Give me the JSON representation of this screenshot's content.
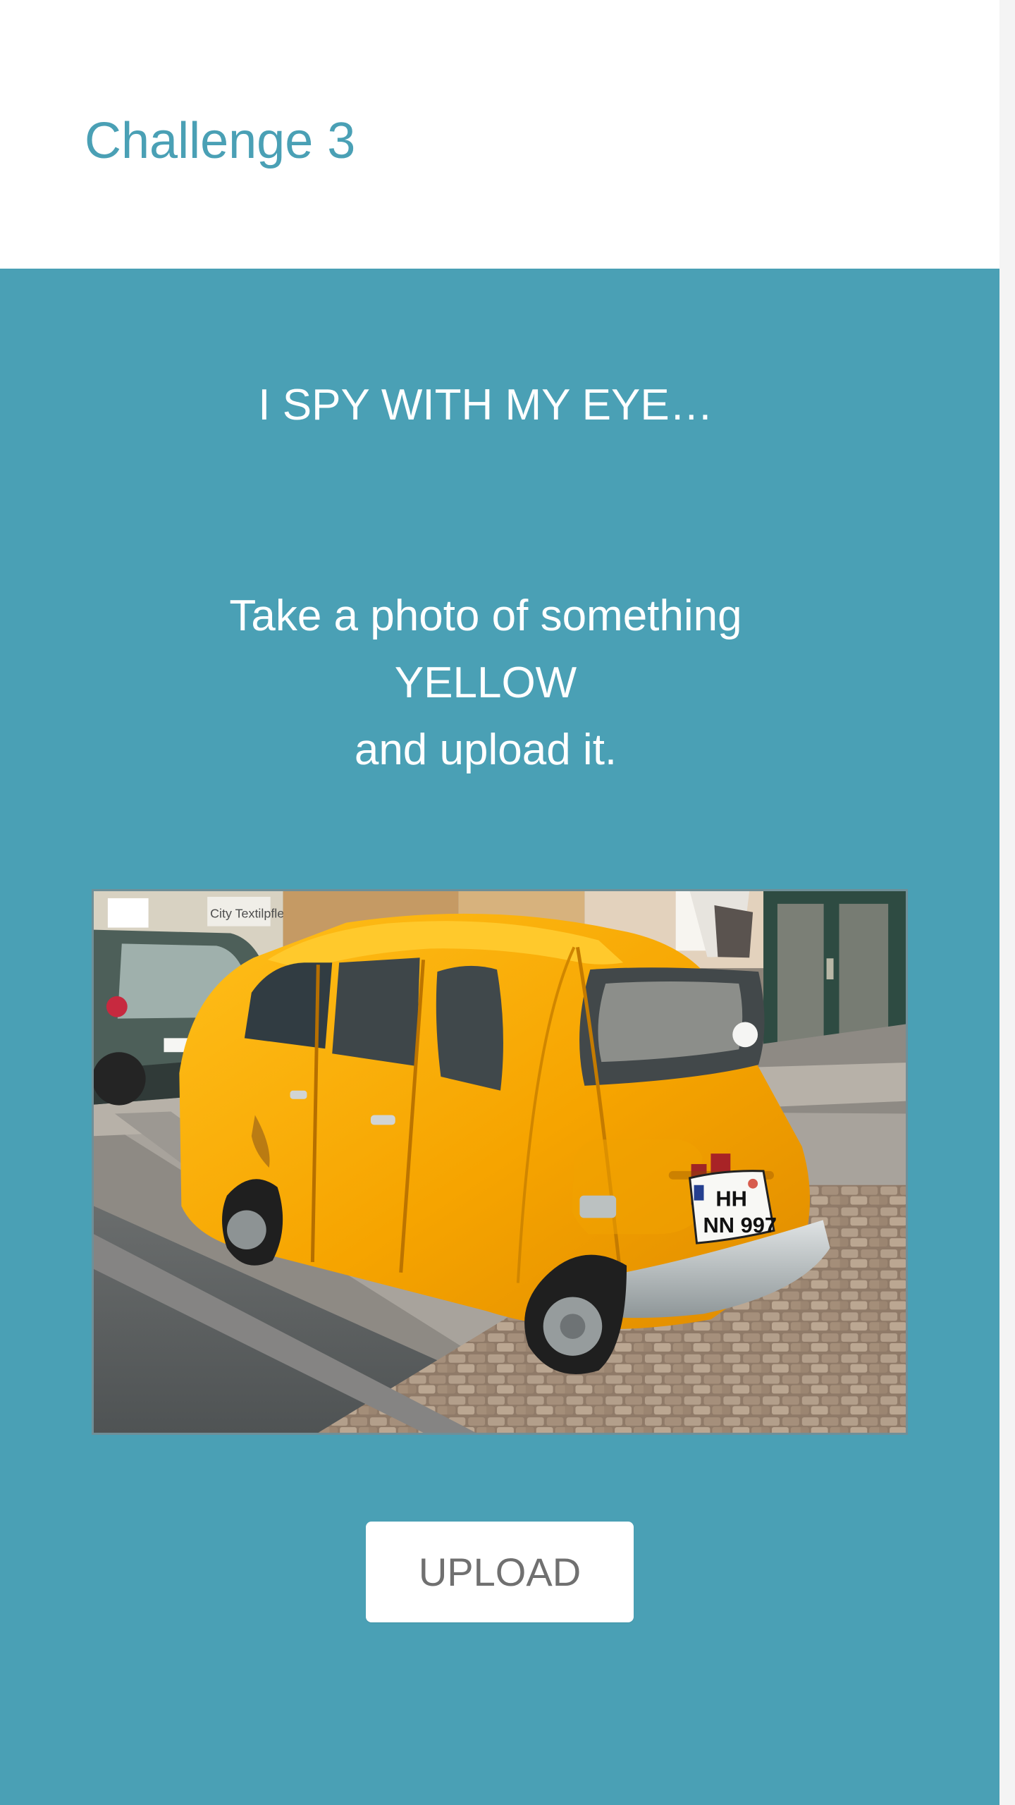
{
  "header": {
    "title": "Challenge 3"
  },
  "challenge": {
    "subtitle": "I SPY WITH MY EYE…",
    "instruction_lines": [
      "Take a photo of something",
      "YELLOW",
      "and upload it."
    ],
    "photo": {
      "plate_line_1": "HH",
      "plate_line_2": "NN 997",
      "sign_text": "City Textilpfle"
    },
    "upload_label": "UPLOAD"
  },
  "colors": {
    "accent": "#4aa0b5",
    "header_background": "#ffffff",
    "button_text": "#707070",
    "car_yellow": "#f4a900"
  },
  "icons": {
    "photo": "yellow-car-photo"
  }
}
